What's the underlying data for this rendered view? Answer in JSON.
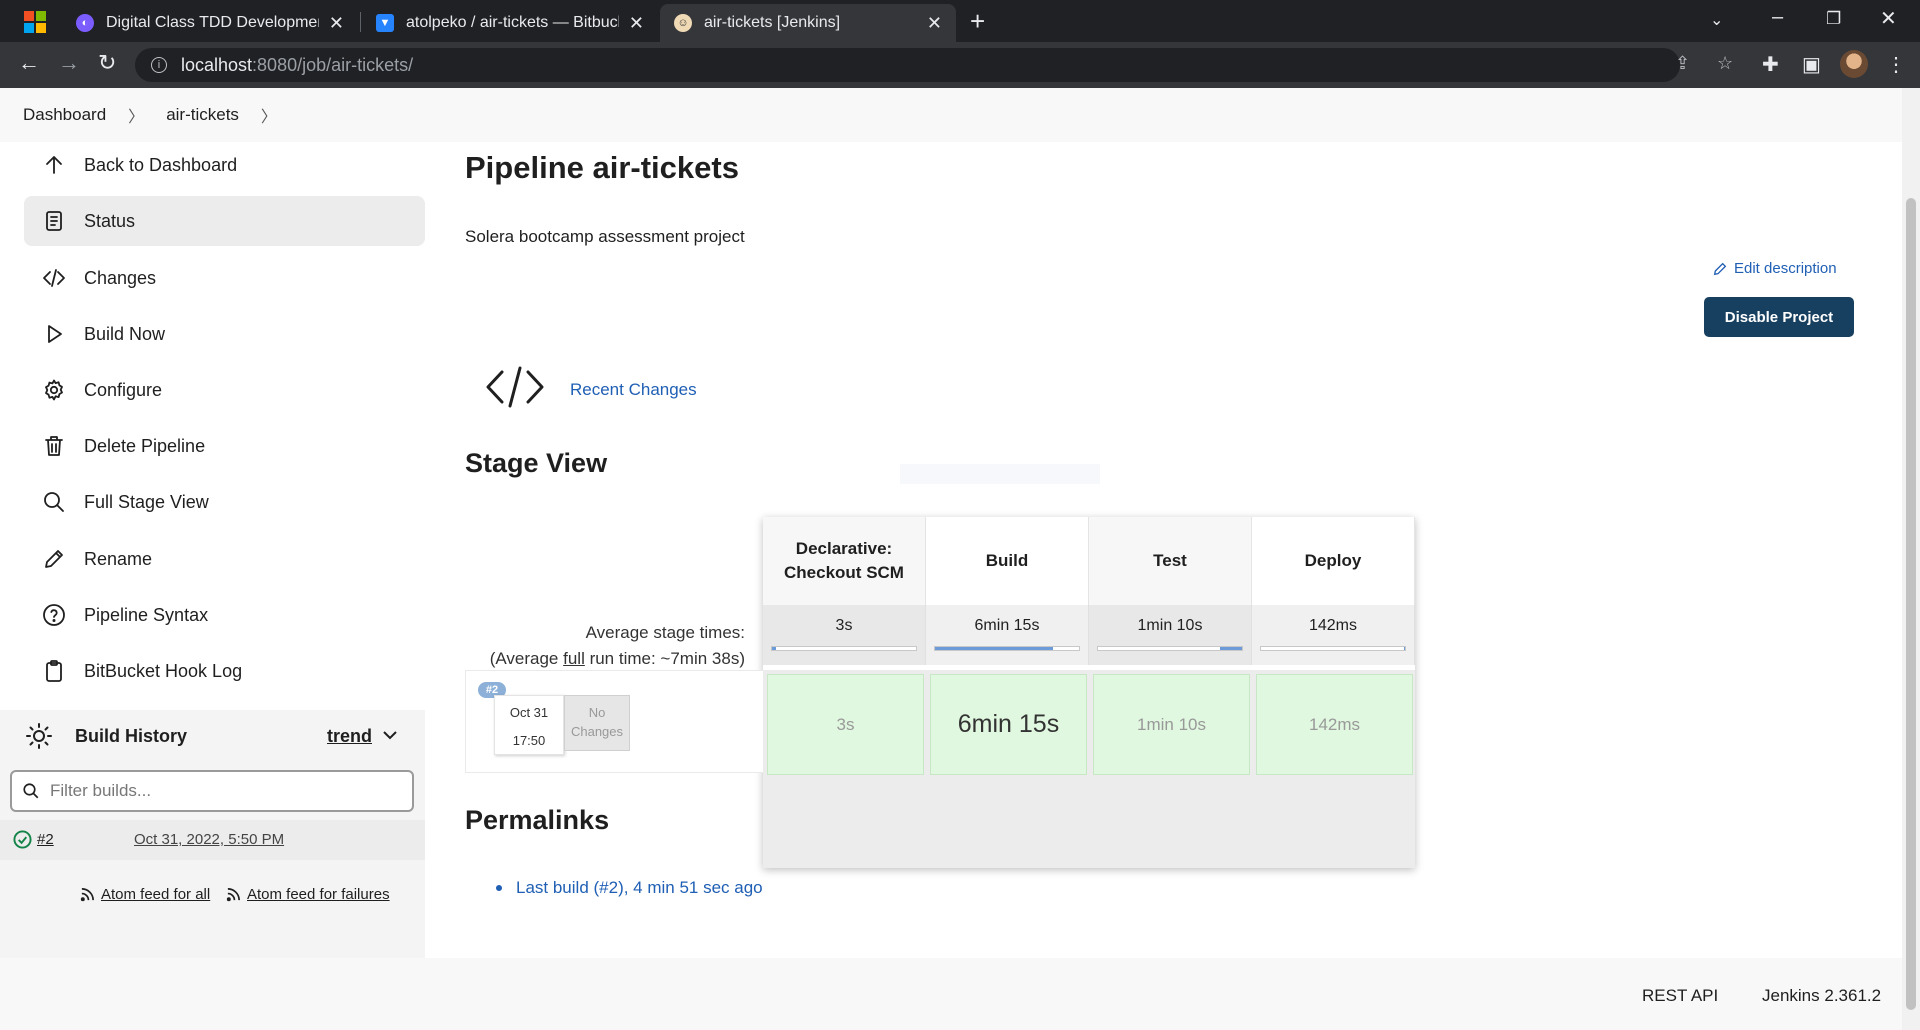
{
  "browser": {
    "tabs": [
      {
        "title": "Digital Class TDD Development A",
        "favicon": "digital-class-icon"
      },
      {
        "title": "atolpeko / air-tickets — Bitbucke",
        "favicon": "bitbucket-icon"
      },
      {
        "title": "air-tickets [Jenkins]",
        "favicon": "jenkins-icon"
      }
    ],
    "url_host": "localhost",
    "url_path": ":8080/job/air-tickets/"
  },
  "breadcrumbs": [
    "Dashboard",
    "air-tickets"
  ],
  "sidebar": {
    "items": [
      {
        "label": "Back to Dashboard",
        "icon": "arrow-up-icon"
      },
      {
        "label": "Status",
        "icon": "document-icon"
      },
      {
        "label": "Changes",
        "icon": "code-icon"
      },
      {
        "label": "Build Now",
        "icon": "play-icon"
      },
      {
        "label": "Configure",
        "icon": "gear-icon"
      },
      {
        "label": "Delete Pipeline",
        "icon": "trash-icon"
      },
      {
        "label": "Full Stage View",
        "icon": "search-icon"
      },
      {
        "label": "Rename",
        "icon": "pencil-icon"
      },
      {
        "label": "Pipeline Syntax",
        "icon": "help-icon"
      },
      {
        "label": "BitBucket Hook Log",
        "icon": "clipboard-icon"
      }
    ]
  },
  "build_history": {
    "title": "Build History",
    "trend_label": "trend",
    "filter_placeholder": "Filter builds...",
    "builds": [
      {
        "number": "#2",
        "date": "Oct 31, 2022, 5:50 PM",
        "status": "success"
      }
    ],
    "feed_all": "Atom feed for all",
    "feed_failures": "Atom feed for failures"
  },
  "main": {
    "title": "Pipeline air-tickets",
    "description": "Solera bootcamp assessment project",
    "edit_description": "Edit description",
    "disable_button": "Disable Project",
    "recent_changes": "Recent Changes"
  },
  "stage_view": {
    "title": "Stage View",
    "avg_label": "Average stage times:",
    "avg_run_prefix": "(Average ",
    "avg_run_full": "full",
    "avg_run_suffix": " run time: ~7min 38s)",
    "stages": [
      {
        "name": "Declarative: Checkout SCM",
        "avg": "3s",
        "avg_fraction": 0.03,
        "cell": "3s"
      },
      {
        "name": "Build",
        "avg": "6min 15s",
        "avg_fraction": 0.82,
        "cell": "6min 15s"
      },
      {
        "name": "Test",
        "avg": "1min 10s",
        "avg_fraction": 0.15,
        "cell": "1min 10s"
      },
      {
        "name": "Deploy",
        "avg": "142ms",
        "avg_fraction": 0.01,
        "cell": "142ms"
      }
    ],
    "run": {
      "badge": "#2",
      "date": "Oct 31",
      "time": "17:50",
      "changes": "No Changes"
    }
  },
  "permalinks": {
    "title": "Permalinks",
    "items": [
      "Last build (#2), 4 min 51 sec ago"
    ]
  },
  "footer": {
    "rest_api": "REST API",
    "version": "Jenkins 2.361.2"
  },
  "colors": {
    "primary_button": "#173f5f",
    "link": "#1f5fb4",
    "success_cell": "#e0f8df",
    "progress": "#6b9bd8"
  }
}
